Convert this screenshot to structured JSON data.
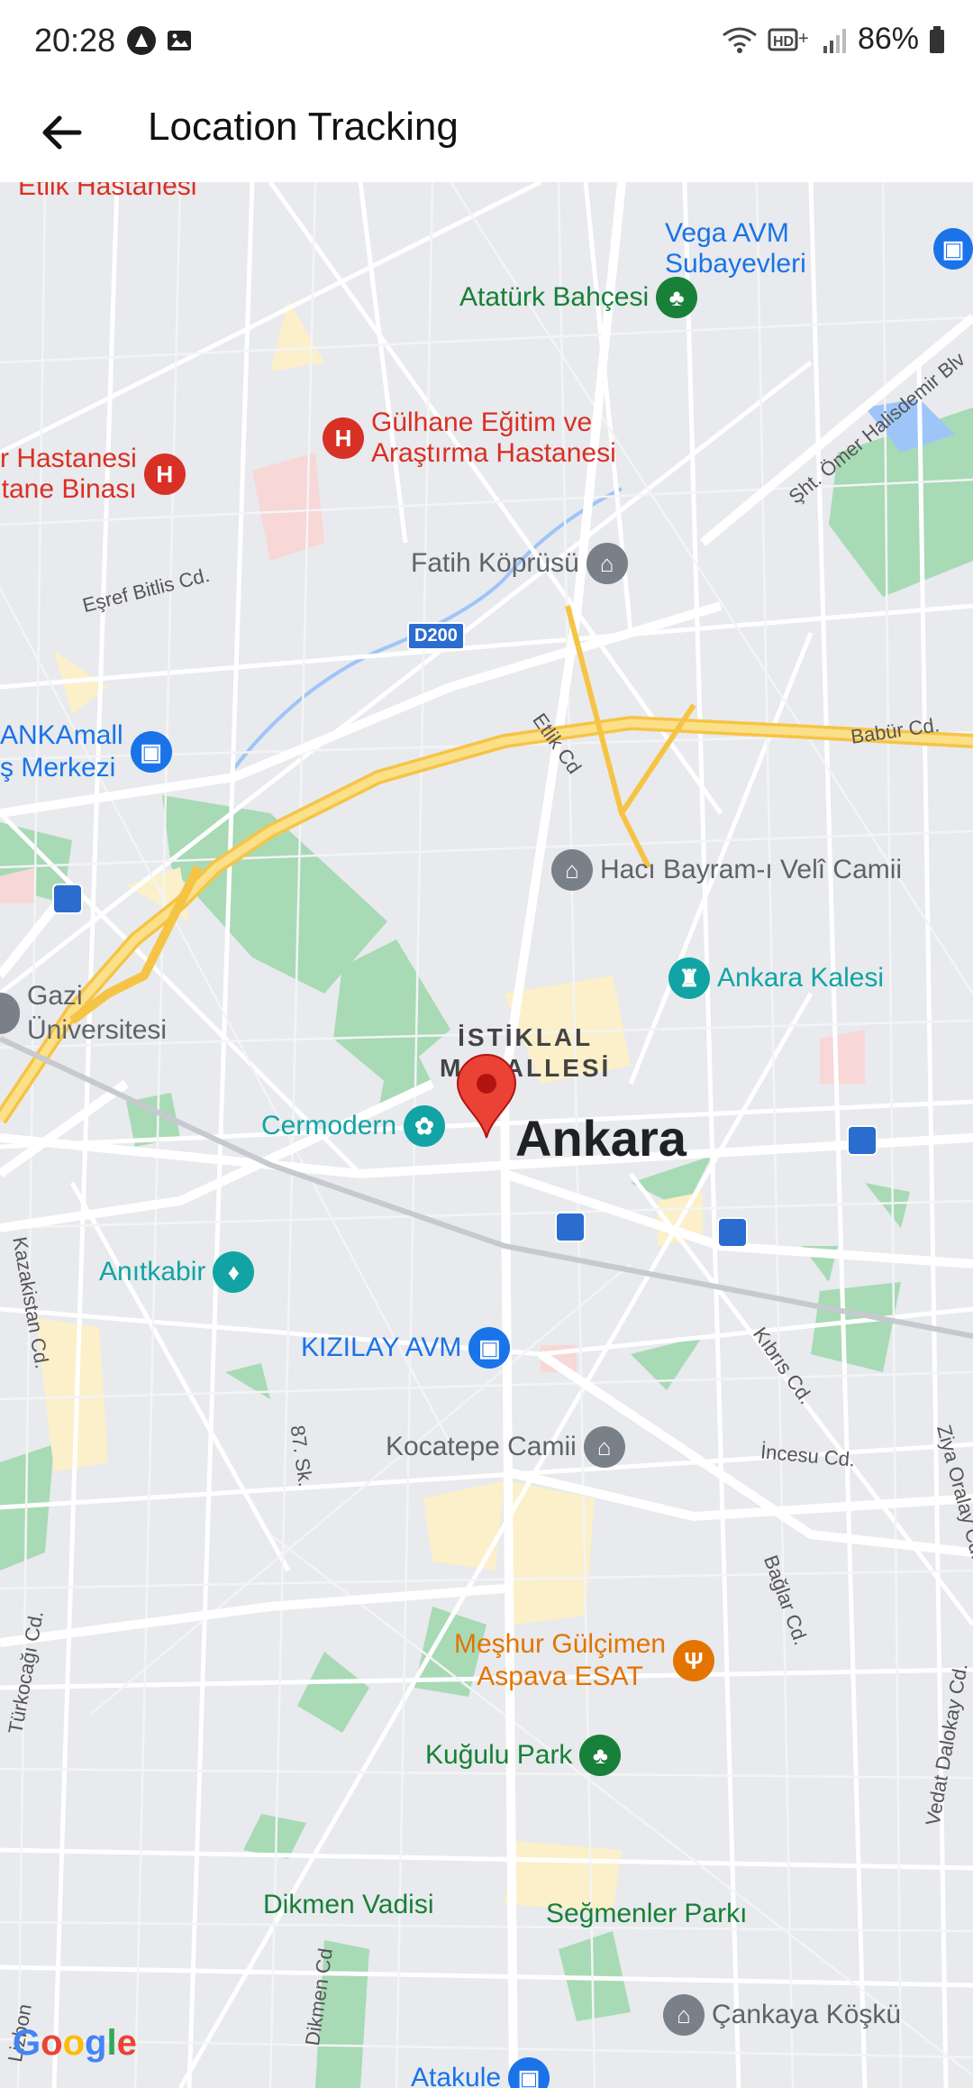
{
  "status": {
    "time": "20:28",
    "battery": "86%"
  },
  "appbar": {
    "title": "Location Tracking"
  },
  "map": {
    "city": "Ankara",
    "district": "İSTİKLAL\nMAHALLESİ",
    "pois": [
      {
        "id": "etlik",
        "name": "Etlik Hastanesi",
        "color": "#d93025",
        "type": "hospital"
      },
      {
        "id": "vega",
        "name": "Vega AVM Subayevleri",
        "color": "#1a73e8",
        "type": "shop"
      },
      {
        "id": "ataturk",
        "name": "Atatürk Bahçesi",
        "color": "#188038",
        "type": "park"
      },
      {
        "id": "gulhane",
        "name": "Gülhane Eğitim ve\nAraştırma Hastanesi",
        "color": "#d93025",
        "type": "hospital"
      },
      {
        "id": "hastanesi",
        "name": "r Hastanesi\ntane Binası",
        "color": "#d93025",
        "type": "hospital"
      },
      {
        "id": "fatih",
        "name": "Fatih Köprüsü",
        "color": "#5f6368",
        "type": "landmark"
      },
      {
        "id": "ankamall",
        "name": "ANKAmall\nş Merkezi",
        "color": "#1a73e8",
        "type": "shop"
      },
      {
        "id": "haci",
        "name": "Hacı Bayram-ı Velî Camii",
        "color": "#5f6368",
        "type": "mosque"
      },
      {
        "id": "kalesi",
        "name": "Ankara Kalesi",
        "color": "#12a4a4",
        "type": "castle"
      },
      {
        "id": "gazi",
        "name": "Gazi\nÜniversitesi",
        "color": "#5f6368",
        "type": "univ"
      },
      {
        "id": "cermodern",
        "name": "Cermodern",
        "color": "#12a4a4",
        "type": "museum"
      },
      {
        "id": "anitkabir",
        "name": "Anıtkabir",
        "color": "#12a4a4",
        "type": "monument"
      },
      {
        "id": "kizilay",
        "name": "KIZILAY AVM",
        "color": "#1a73e8",
        "type": "shop"
      },
      {
        "id": "kocatepe",
        "name": "Kocatepe Camii",
        "color": "#5f6368",
        "type": "mosque"
      },
      {
        "id": "meshur",
        "name": "Meşhur Gülçimen\nAspava ESAT",
        "color": "#e37400",
        "type": "food"
      },
      {
        "id": "kugulu",
        "name": "Kuğulu Park",
        "color": "#188038",
        "type": "park"
      },
      {
        "id": "dikmen",
        "name": "Dikmen Vadisi",
        "color": "#188038",
        "type": "park"
      },
      {
        "id": "segmenler",
        "name": "Seğmenler Parkı",
        "color": "#188038",
        "type": "park"
      },
      {
        "id": "cankaya",
        "name": "Çankaya Köşkü",
        "color": "#5f6368",
        "type": "landmark"
      },
      {
        "id": "atakule",
        "name": "Atakule",
        "color": "#1a73e8",
        "type": "shop"
      }
    ],
    "roads": [
      "Eşref Bitlis Cd.",
      "Etlik Cd",
      "Babür Cd.",
      "Şht. Ömer Halisdemir Blv",
      "Kazakistan Cd.",
      "87. Sk.",
      "Kıbrıs Cd.",
      "İncesu Cd.",
      "Ziya Oralay Cd.",
      "Bağlar Cd.",
      "Vedat Dalokay Cd.",
      "Türkocağı Cd.",
      "Dikmen Cd",
      "Lizbon"
    ],
    "highway": "D200",
    "attribution": "Google"
  },
  "icons": {
    "back": "arrow-left-icon",
    "marker": "location-pin-icon"
  }
}
